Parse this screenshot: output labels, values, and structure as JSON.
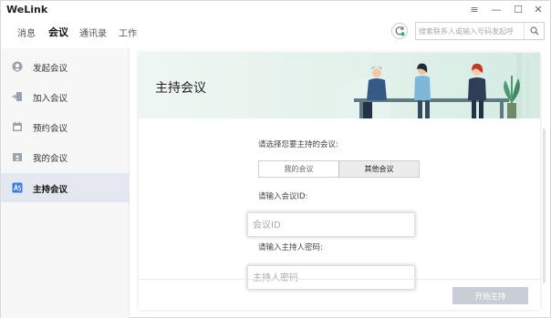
{
  "app": {
    "title": "WeLink"
  },
  "window_controls": {
    "menu": "≡",
    "minimize": "—",
    "maximize": "☐",
    "close": "✕"
  },
  "nav": {
    "tabs": [
      {
        "label": "消息"
      },
      {
        "label": "会议",
        "active": true
      },
      {
        "label": "通讯录"
      },
      {
        "label": "工作"
      }
    ],
    "search": {
      "placeholder": "搜索联系人或输入号码发起呼"
    }
  },
  "sidebar": {
    "items": [
      {
        "label": "发起会议",
        "icon": "start-meeting-icon"
      },
      {
        "label": "加入会议",
        "icon": "join-meeting-icon"
      },
      {
        "label": "预约会议",
        "icon": "schedule-meeting-icon"
      },
      {
        "label": "我的会议",
        "icon": "my-meeting-icon"
      },
      {
        "label": "主持会议",
        "icon": "host-meeting-icon",
        "active": true
      }
    ]
  },
  "main": {
    "title": "主持会议",
    "select_prompt": "请选择您要主持的会议:",
    "options": [
      {
        "label": "我的会议"
      },
      {
        "label": "其他会议",
        "selected": true
      }
    ],
    "id_prompt": "请输入会议ID:",
    "id_placeholder": "会议ID",
    "pwd_prompt": "请输入主持人密码:",
    "pwd_placeholder": "主持人密码",
    "start_button": "开始主持"
  },
  "colors": {
    "accent": "#3b7ddd",
    "active_bg": "#e3e8f0",
    "hero_bg": "#e3f1eb",
    "disabled_button": "#c9ced6"
  }
}
